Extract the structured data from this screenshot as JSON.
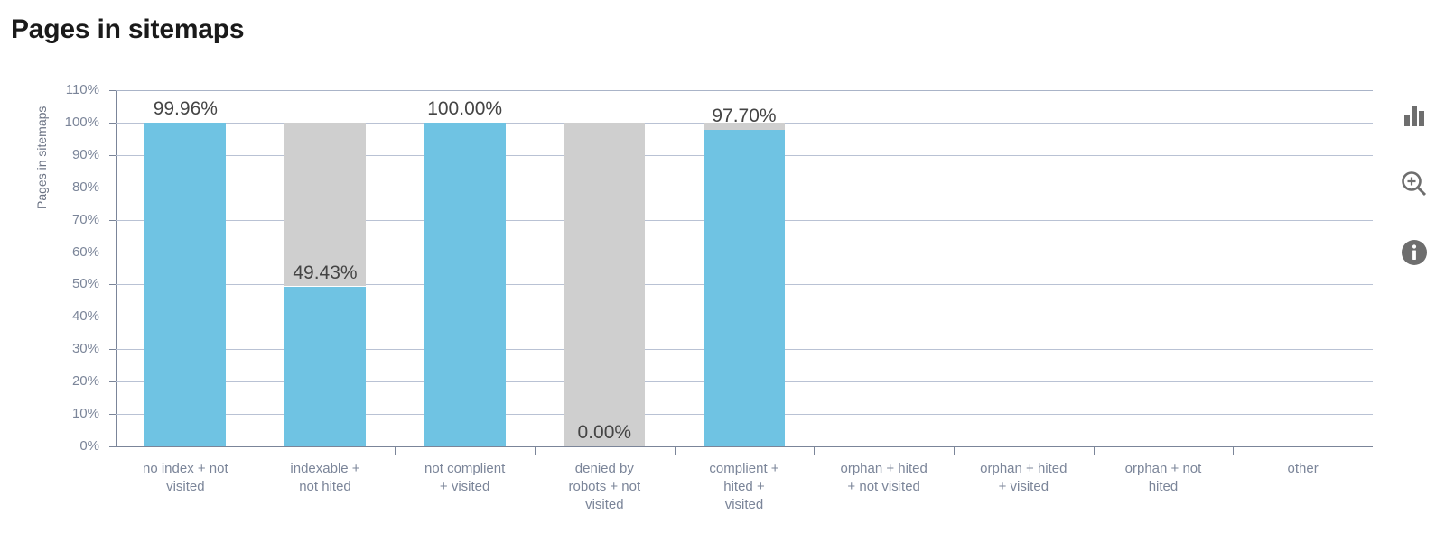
{
  "page_title": "Pages in sitemaps",
  "toolbar": {
    "items": [
      {
        "name": "bar-chart-icon",
        "label": "Chart type"
      },
      {
        "name": "zoom-in-icon",
        "label": "Zoom"
      },
      {
        "name": "info-icon",
        "label": "Info"
      }
    ]
  },
  "colors": {
    "bar_blue": "#6fc3e3",
    "bar_grey": "#cfcfcf",
    "axis": "#7b8599",
    "gridline": "#aab4c8",
    "title_text": "#1a1a1a",
    "value_label": "#444444"
  },
  "chart_data": {
    "type": "bar",
    "title": "Pages in sitemaps",
    "xlabel": "",
    "ylabel": "Pages in sitemaps",
    "ylim": [
      0,
      110
    ],
    "ytick_labels": [
      "110%",
      "100%",
      "90%",
      "80%",
      "70%",
      "60%",
      "50%",
      "40%",
      "30%",
      "20%",
      "10%",
      "0%"
    ],
    "ytick_values": [
      110,
      100,
      90,
      80,
      70,
      60,
      50,
      40,
      30,
      20,
      10,
      0
    ],
    "grid": true,
    "legend": "none",
    "stacked": true,
    "categories": [
      "no index + not\nvisited",
      "indexable +\nnot hited",
      "not complient\n+ visited",
      "denied by\nrobots + not\nvisited",
      "complient +\nhited +\nvisited",
      "orphan + hited\n+ not visited",
      "orphan + hited\n+ visited",
      "orphan + not\nhited",
      "other"
    ],
    "series": [
      {
        "name": "Pages in sitemaps",
        "color": "#6fc3e3",
        "values": [
          99.96,
          49.43,
          100.0,
          0.0,
          97.7,
          null,
          null,
          null,
          null
        ]
      },
      {
        "name": "Remainder",
        "color": "#cfcfcf",
        "values": [
          0.04,
          50.57,
          0.0,
          100.0,
          2.3,
          null,
          null,
          null,
          null
        ]
      }
    ],
    "value_labels": [
      "99.96%",
      "49.43%",
      "100.00%",
      "0.00%",
      "97.70%",
      "",
      "",
      "",
      ""
    ],
    "bars_present": [
      true,
      true,
      true,
      true,
      true,
      false,
      false,
      false,
      false
    ]
  }
}
